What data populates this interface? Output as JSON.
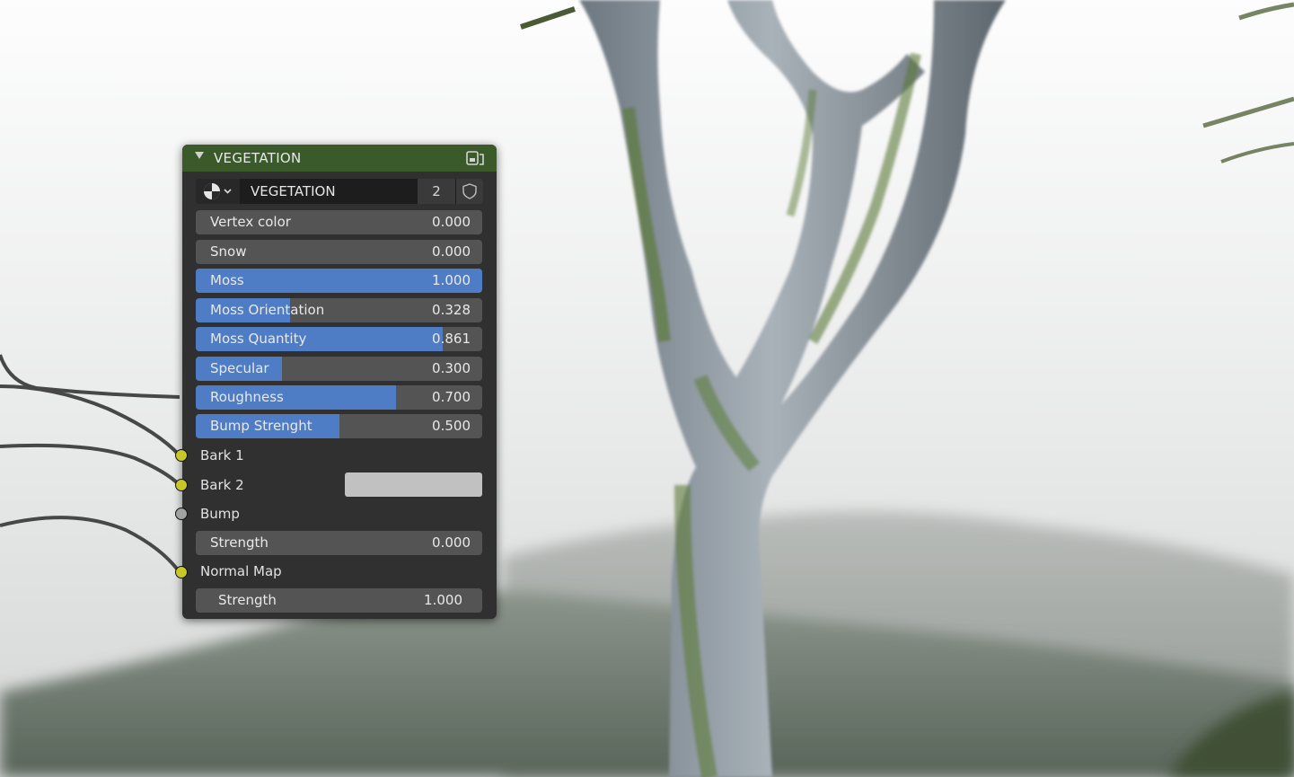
{
  "node": {
    "title": "VEGETATION",
    "header_color": "#3a5a2a",
    "group": {
      "name": "VEGETATION",
      "users": "2"
    },
    "inputs": [
      {
        "label": "Vertex color",
        "value": "0.000",
        "fill": 0.0
      },
      {
        "label": "Snow",
        "value": "0.000",
        "fill": 0.0
      },
      {
        "label": "Moss",
        "value": "1.000",
        "fill": 1.0
      },
      {
        "label": "Moss Orientation",
        "value": "0.328",
        "fill": 0.328
      },
      {
        "label": "Moss Quantity",
        "value": "0.861",
        "fill": 0.861
      },
      {
        "label": "Specular",
        "value": "0.300",
        "fill": 0.3
      },
      {
        "label": "Roughness",
        "value": "0.700",
        "fill": 0.7
      },
      {
        "label": "Bump Strenght",
        "value": "0.500",
        "fill": 0.5
      }
    ],
    "bark1": "Bark 1",
    "bark2": "Bark 2",
    "bark2_color": "#c1c1c1",
    "bump": "Bump",
    "bump_strength": {
      "label": "Strength",
      "value": "0.000"
    },
    "normal_map": "Normal Map",
    "normal_strength": {
      "label": "Strength",
      "value": "1.000"
    }
  },
  "colors": {
    "slider_fill": "#4e7dc6",
    "socket_grey": "#a1a1a1",
    "socket_yellow": "#c7c729"
  }
}
